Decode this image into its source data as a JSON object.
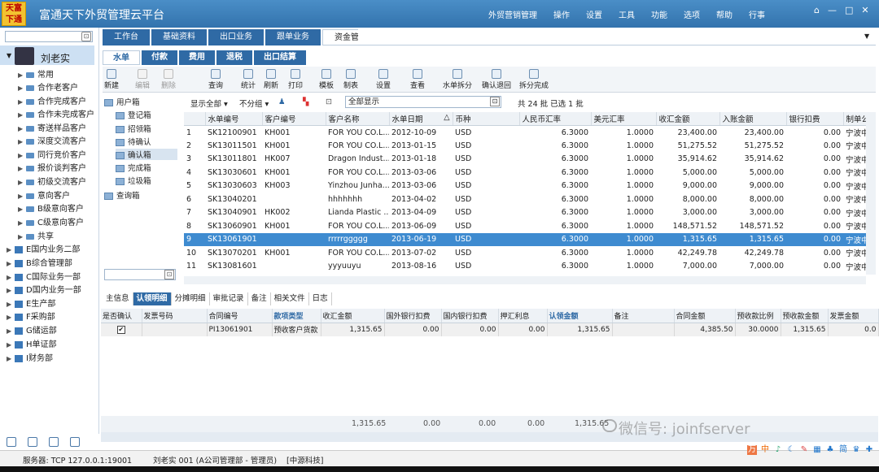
{
  "app": {
    "logo_text": "天富下通",
    "title": "富通天下外贸管理云平台"
  },
  "topnav": {
    "items": [
      "外贸营销管理",
      "操作",
      "设置",
      "工具",
      "功能",
      "选项",
      "帮助",
      "行事"
    ]
  },
  "window_controls": [
    "⌂",
    "—",
    "□",
    "✕"
  ],
  "sidebar": {
    "user": "刘老实",
    "items": [
      "常用",
      "合作老客户",
      "合作完成客户",
      "合作未完成客户",
      "寄送样品客户",
      "深度交流客户",
      "同行竞价客户",
      "报价谈判客户",
      "初级交流客户",
      "意向客户",
      "B级意向客户",
      "C级意向客户",
      "共享"
    ],
    "orgs": [
      "E国内业务二部",
      "B综合管理部",
      "C国际业务一部",
      "D国内业务一部",
      "E生产部",
      "F采购部",
      "G储运部",
      "H单证部",
      "I财务部"
    ]
  },
  "tabs_primary": [
    "工作台",
    "基础资料",
    "出口业务",
    "跟单业务",
    "资金管理"
  ],
  "tabs_secondary": [
    "水单",
    "付款",
    "费用",
    "退税",
    "出口结算"
  ],
  "toolbar": [
    "新建",
    "编辑",
    "删除",
    "查询",
    "统计",
    "刷新",
    "打印",
    "模板",
    "制表",
    "设置",
    "查看",
    "水单拆分",
    "确认退回",
    "拆分完成"
  ],
  "inbox": {
    "root": "用户箱",
    "items": [
      "登记箱",
      "招领箱",
      "待确认",
      "确认箱",
      "完成箱",
      "垃圾箱",
      "查询箱"
    ]
  },
  "filter": {
    "show_all": "显示全部",
    "no_group": "不分组",
    "search_value": "全部显示",
    "summary": "共 24 批  已选 1 批"
  },
  "table": {
    "columns": [
      "",
      "水单编号",
      "客户编号",
      "客户名称",
      "水单日期",
      "币种",
      "人民币汇率",
      "美元汇率",
      "收汇金额",
      "入账金额",
      "银行扣费",
      "制单公"
    ],
    "rows": [
      [
        "1",
        "SK12100901",
        "KH001",
        "FOR YOU CO.L...",
        "2012-10-09",
        "USD",
        "6.3000",
        "1.0000",
        "23,400.00",
        "23,400.00",
        "0.00",
        "宁波中"
      ],
      [
        "2",
        "SK13011501",
        "KH001",
        "FOR YOU CO.L...",
        "2013-01-15",
        "USD",
        "6.3000",
        "1.0000",
        "51,275.52",
        "51,275.52",
        "0.00",
        "宁波中"
      ],
      [
        "3",
        "SK13011801",
        "HK007",
        "Dragon Indust...",
        "2013-01-18",
        "USD",
        "6.3000",
        "1.0000",
        "35,914.62",
        "35,914.62",
        "0.00",
        "宁波中"
      ],
      [
        "4",
        "SK13030601",
        "KH001",
        "FOR YOU CO.L...",
        "2013-03-06",
        "USD",
        "6.3000",
        "1.0000",
        "5,000.00",
        "5,000.00",
        "0.00",
        "宁波中"
      ],
      [
        "5",
        "SK13030603",
        "KH003",
        "Yinzhou Junha...",
        "2013-03-06",
        "USD",
        "6.3000",
        "1.0000",
        "9,000.00",
        "9,000.00",
        "0.00",
        "宁波中"
      ],
      [
        "6",
        "SK13040201",
        "",
        "hhhhhhh",
        "2013-04-02",
        "USD",
        "6.3000",
        "1.0000",
        "8,000.00",
        "8,000.00",
        "0.00",
        "宁波中"
      ],
      [
        "7",
        "SK13040901",
        "HK002",
        "Lianda Plastic ...",
        "2013-04-09",
        "USD",
        "6.3000",
        "1.0000",
        "3,000.00",
        "3,000.00",
        "0.00",
        "宁波中"
      ],
      [
        "8",
        "SK13060901",
        "KH001",
        "FOR YOU CO.L...",
        "2013-06-09",
        "USD",
        "6.3000",
        "1.0000",
        "148,571.52",
        "148,571.52",
        "0.00",
        "宁波中"
      ],
      [
        "9",
        "SK13061901",
        "",
        "rrrrrggggg",
        "2013-06-19",
        "USD",
        "6.3000",
        "1.0000",
        "1,315.65",
        "1,315.65",
        "0.00",
        "宁波中"
      ],
      [
        "10",
        "SK13070201",
        "KH001",
        "FOR YOU CO.L...",
        "2013-07-02",
        "USD",
        "6.3000",
        "1.0000",
        "42,249.78",
        "42,249.78",
        "0.00",
        "宁波中"
      ],
      [
        "11",
        "SK13081601",
        "",
        "yyyuuyu",
        "2013-08-16",
        "USD",
        "6.3000",
        "1.0000",
        "7,000.00",
        "7,000.00",
        "0.00",
        "宁波中"
      ]
    ]
  },
  "detail_tabs": [
    "主信息",
    "认领明细",
    "分摊明细",
    "审批记录",
    "备注",
    "相关文件",
    "日志"
  ],
  "detail": {
    "columns": [
      "是否确认",
      "发票号码",
      "合同编号",
      "款项类型",
      "收汇金额",
      "国外银行扣费",
      "国内银行扣费",
      "押汇利息",
      "认领金额",
      "备注",
      "合同金额",
      "预收款比例",
      "预收款金额",
      "发票金额"
    ],
    "row": [
      "✔",
      "",
      "PI13061901",
      "预收客户货款",
      "1,315.65",
      "0.00",
      "0.00",
      "0.00",
      "1,315.65",
      "",
      "4,385.50",
      "30.0000",
      "1,315.65",
      "0.0"
    ],
    "totals": [
      "1,315.65",
      "0.00",
      "0.00",
      "0.00",
      "1,315.65"
    ]
  },
  "status": {
    "server": "服务器: TCP  127.0.0.1:19001",
    "user": "刘老实 001 (A公司管理部 - 管理员)",
    "company": "[中源科技]"
  },
  "watermark": "微信号: joinfserver",
  "ime": [
    "万",
    "中",
    "♪",
    "☾",
    "✎",
    "▦",
    "♣",
    "简",
    "♛",
    "✚"
  ]
}
